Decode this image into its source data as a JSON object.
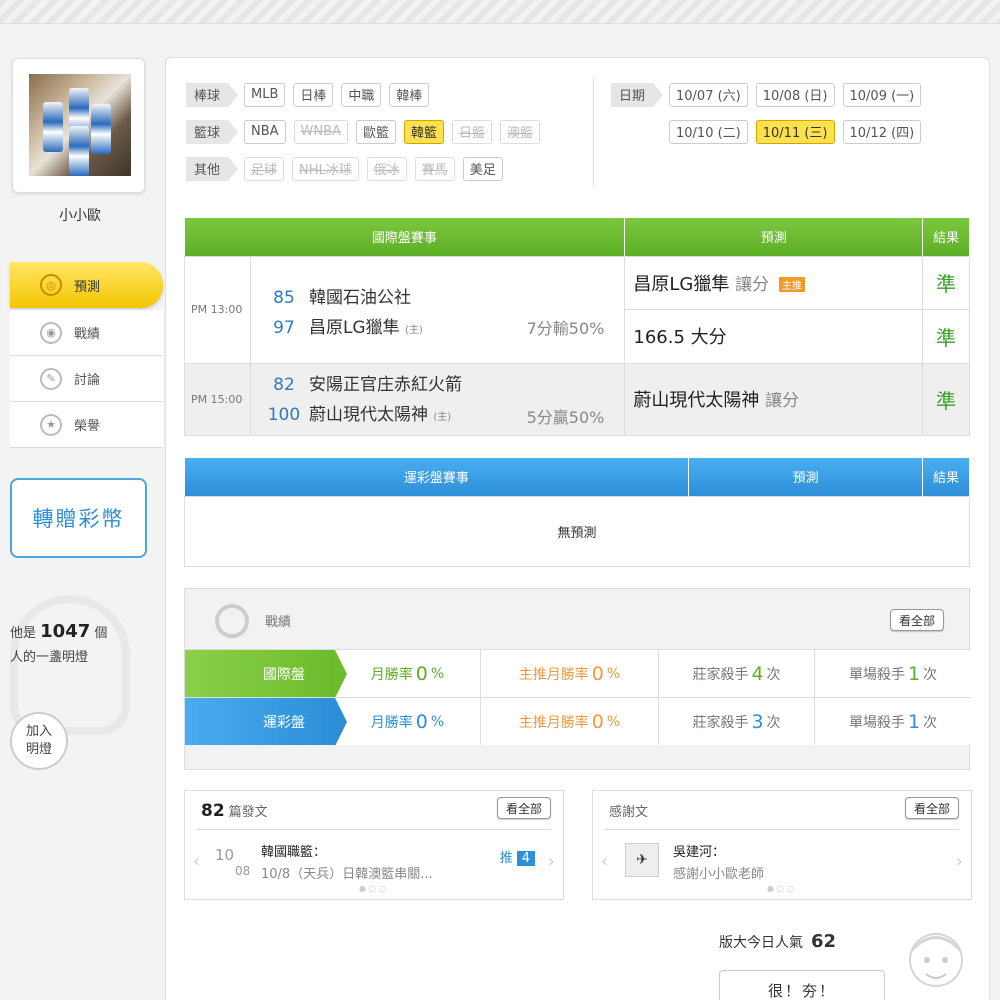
{
  "profile": {
    "name": "小小歐"
  },
  "nav": [
    {
      "label": "預測",
      "icon": "target-icon"
    },
    {
      "label": "戰績",
      "icon": "record-icon"
    },
    {
      "label": "討論",
      "icon": "discuss-icon"
    },
    {
      "label": "榮譽",
      "icon": "medal-icon"
    }
  ],
  "transfer_label": "轉贈彩幣",
  "fan": {
    "prefix": "他是",
    "count": "1047",
    "suffix": "個",
    "line2": "人的一盞明燈",
    "add_label": "加入明燈"
  },
  "filters": {
    "baseball": {
      "label": "棒球",
      "chips": [
        "MLB",
        "日棒",
        "中職",
        "韓棒"
      ]
    },
    "basketball": {
      "label": "籃球",
      "chips": [
        "NBA",
        "WNBA",
        "歐籃",
        "韓籃",
        "日籃",
        "澳籃"
      ]
    },
    "other": {
      "label": "其他",
      "chips": [
        "足球",
        "NHL冰球",
        "俄冰",
        "賽馬",
        "美足"
      ]
    },
    "date_label": "日期",
    "dates_row1": [
      "10/07 (六)",
      "10/08 (日)",
      "10/09 (一)"
    ],
    "dates_row2": [
      "10/10 (二)",
      "10/11 (三)",
      "10/12 (四)"
    ]
  },
  "intl": {
    "headers": [
      "國際盤賽事",
      "預測",
      "結果"
    ],
    "game1": {
      "time": "PM 13:00",
      "away_score": "85",
      "away_team": "韓國石油公社",
      "home_score": "97",
      "home_team": "昌原LG獵隼",
      "home_tag": "(主)",
      "handicap": "7分輸50%",
      "pred1_team": "昌原LG獵隼",
      "pred1_type": "讓分",
      "pred1_tag": "主推",
      "pred1_result": "準",
      "pred2_text": "166.5 大分",
      "pred2_result": "準"
    },
    "game2": {
      "time": "PM 15:00",
      "away_score": "82",
      "away_team": "安陽正官庄赤紅火箭",
      "home_score": "100",
      "home_team": "蔚山現代太陽神",
      "home_tag": "(主)",
      "handicap": "5分贏50%",
      "pred_team": "蔚山現代太陽神",
      "pred_type": "讓分",
      "pred_result": "準"
    }
  },
  "lottery": {
    "headers": [
      "運彩盤賽事",
      "預測",
      "結果"
    ],
    "empty": "無預測"
  },
  "record": {
    "title": "戰績",
    "see_all": "看全部",
    "rows": [
      {
        "label": "國際盤",
        "month_label": "月勝率",
        "month": "0",
        "top_label": "主推月勝率",
        "top": "0",
        "pct": "%",
        "killer_label": "莊家殺手",
        "killer": "4",
        "single_label": "單場殺手",
        "single": "1",
        "times": "次"
      },
      {
        "label": "運彩盤",
        "month_label": "月勝率",
        "month": "0",
        "top_label": "主推月勝率",
        "top": "0",
        "pct": "%",
        "killer_label": "莊家殺手",
        "killer": "3",
        "single_label": "單場殺手",
        "single": "1",
        "times": "次"
      }
    ]
  },
  "posts": {
    "count": "82",
    "label": "篇發文",
    "see_all": "看全部",
    "month": "10",
    "day": "08",
    "title": "韓國職籃：",
    "sub": "10/8（天兵）日韓澳籃串關...",
    "push_label": "推",
    "push": "4"
  },
  "thanks": {
    "label": "感謝文",
    "see_all": "看全部",
    "author": "吳建河：",
    "text": "感謝小小歐老師"
  },
  "popularity": {
    "label": "版大今日人氣",
    "value": "62"
  },
  "good_label": "很！夯！",
  "colors": {
    "green": "#5caf26",
    "blue": "#2d8fd8",
    "yellow": "#ffe14d"
  }
}
